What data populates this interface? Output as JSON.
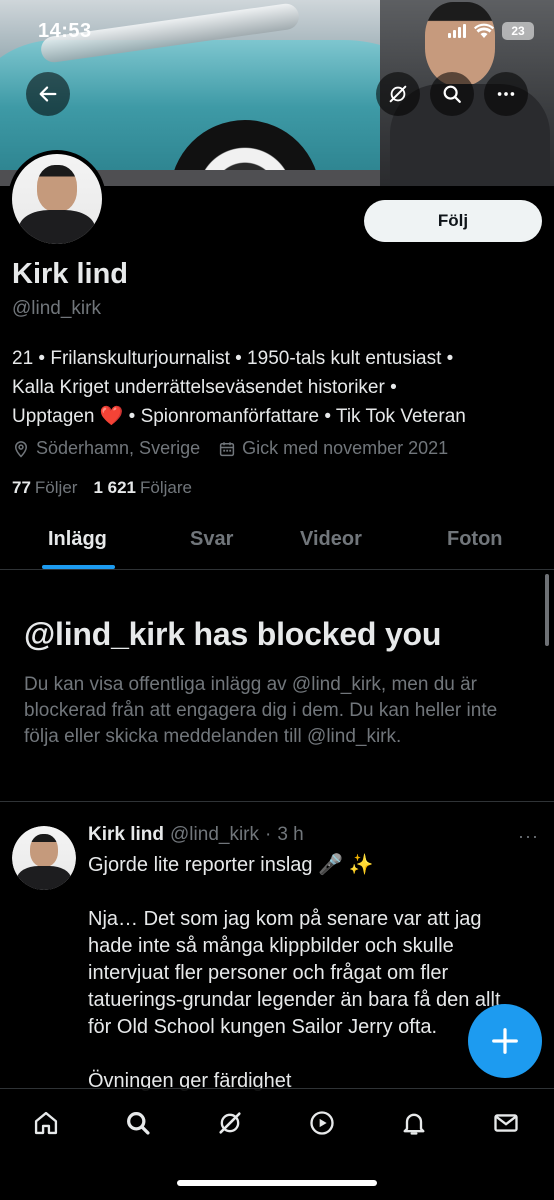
{
  "status_bar": {
    "time": "14:53",
    "battery": "23"
  },
  "header": {
    "back_icon": "arrow-left-icon",
    "grok_icon": "grok-icon",
    "search_icon": "search-icon",
    "more_icon": "more-horizontal-icon"
  },
  "profile": {
    "name": "Kirk lind",
    "handle": "@lind_kirk",
    "follow_label": "Följ",
    "bio_line1": "21 • Frilanskulturjournalist • 1950-tals kult entusiast •",
    "bio_line2": "Kalla Kriget underrättelseväsendet historiker •",
    "bio_line3_a": "Upptagen ",
    "bio_heart": "❤️",
    "bio_line3_b": " • Spionromanförfattare • Tik Tok Veteran",
    "location": "Söderhamn, Sverige",
    "joined": "Gick med november 2021",
    "following_count": "77",
    "following_label": "Följer",
    "followers_count": "1 621",
    "followers_label": "Följare"
  },
  "tabs": [
    {
      "label": "Inlägg",
      "active": true
    },
    {
      "label": "Svar",
      "active": false
    },
    {
      "label": "Videor",
      "active": false
    },
    {
      "label": "Foton",
      "active": false
    }
  ],
  "blocked": {
    "title": "@lind_kirk has blocked you",
    "text": "Du kan visa offentliga inlägg av @lind_kirk, men du är blockerad från att engagera dig i dem. Du kan heller inte följa eller skicka meddelanden till @lind_kirk."
  },
  "post": {
    "author": "Kirk lind",
    "handle": "@lind_kirk",
    "separator": "·",
    "time": "3 h",
    "more": "···",
    "text": "Gjorde lite reporter inslag 🎤 ✨\n\nNja… Det som jag kom på senare var att jag hade inte så många klippbilder och skulle intervjuat fler personer och frågat om fler tatuerings-grundar legender än bara få den allt för Old School kungen Sailor Jerry ofta.\n\nÖvningen ger färdighet"
  },
  "colors": {
    "accent": "#1d9bf0",
    "background": "#000000",
    "muted": "#71767b",
    "text": "#e7e9ea",
    "heart": "#e0245e"
  },
  "bottom_nav": [
    "home-icon",
    "search-icon",
    "grok-icon",
    "video-play-icon",
    "notifications-bell-icon",
    "messages-envelope-icon"
  ]
}
